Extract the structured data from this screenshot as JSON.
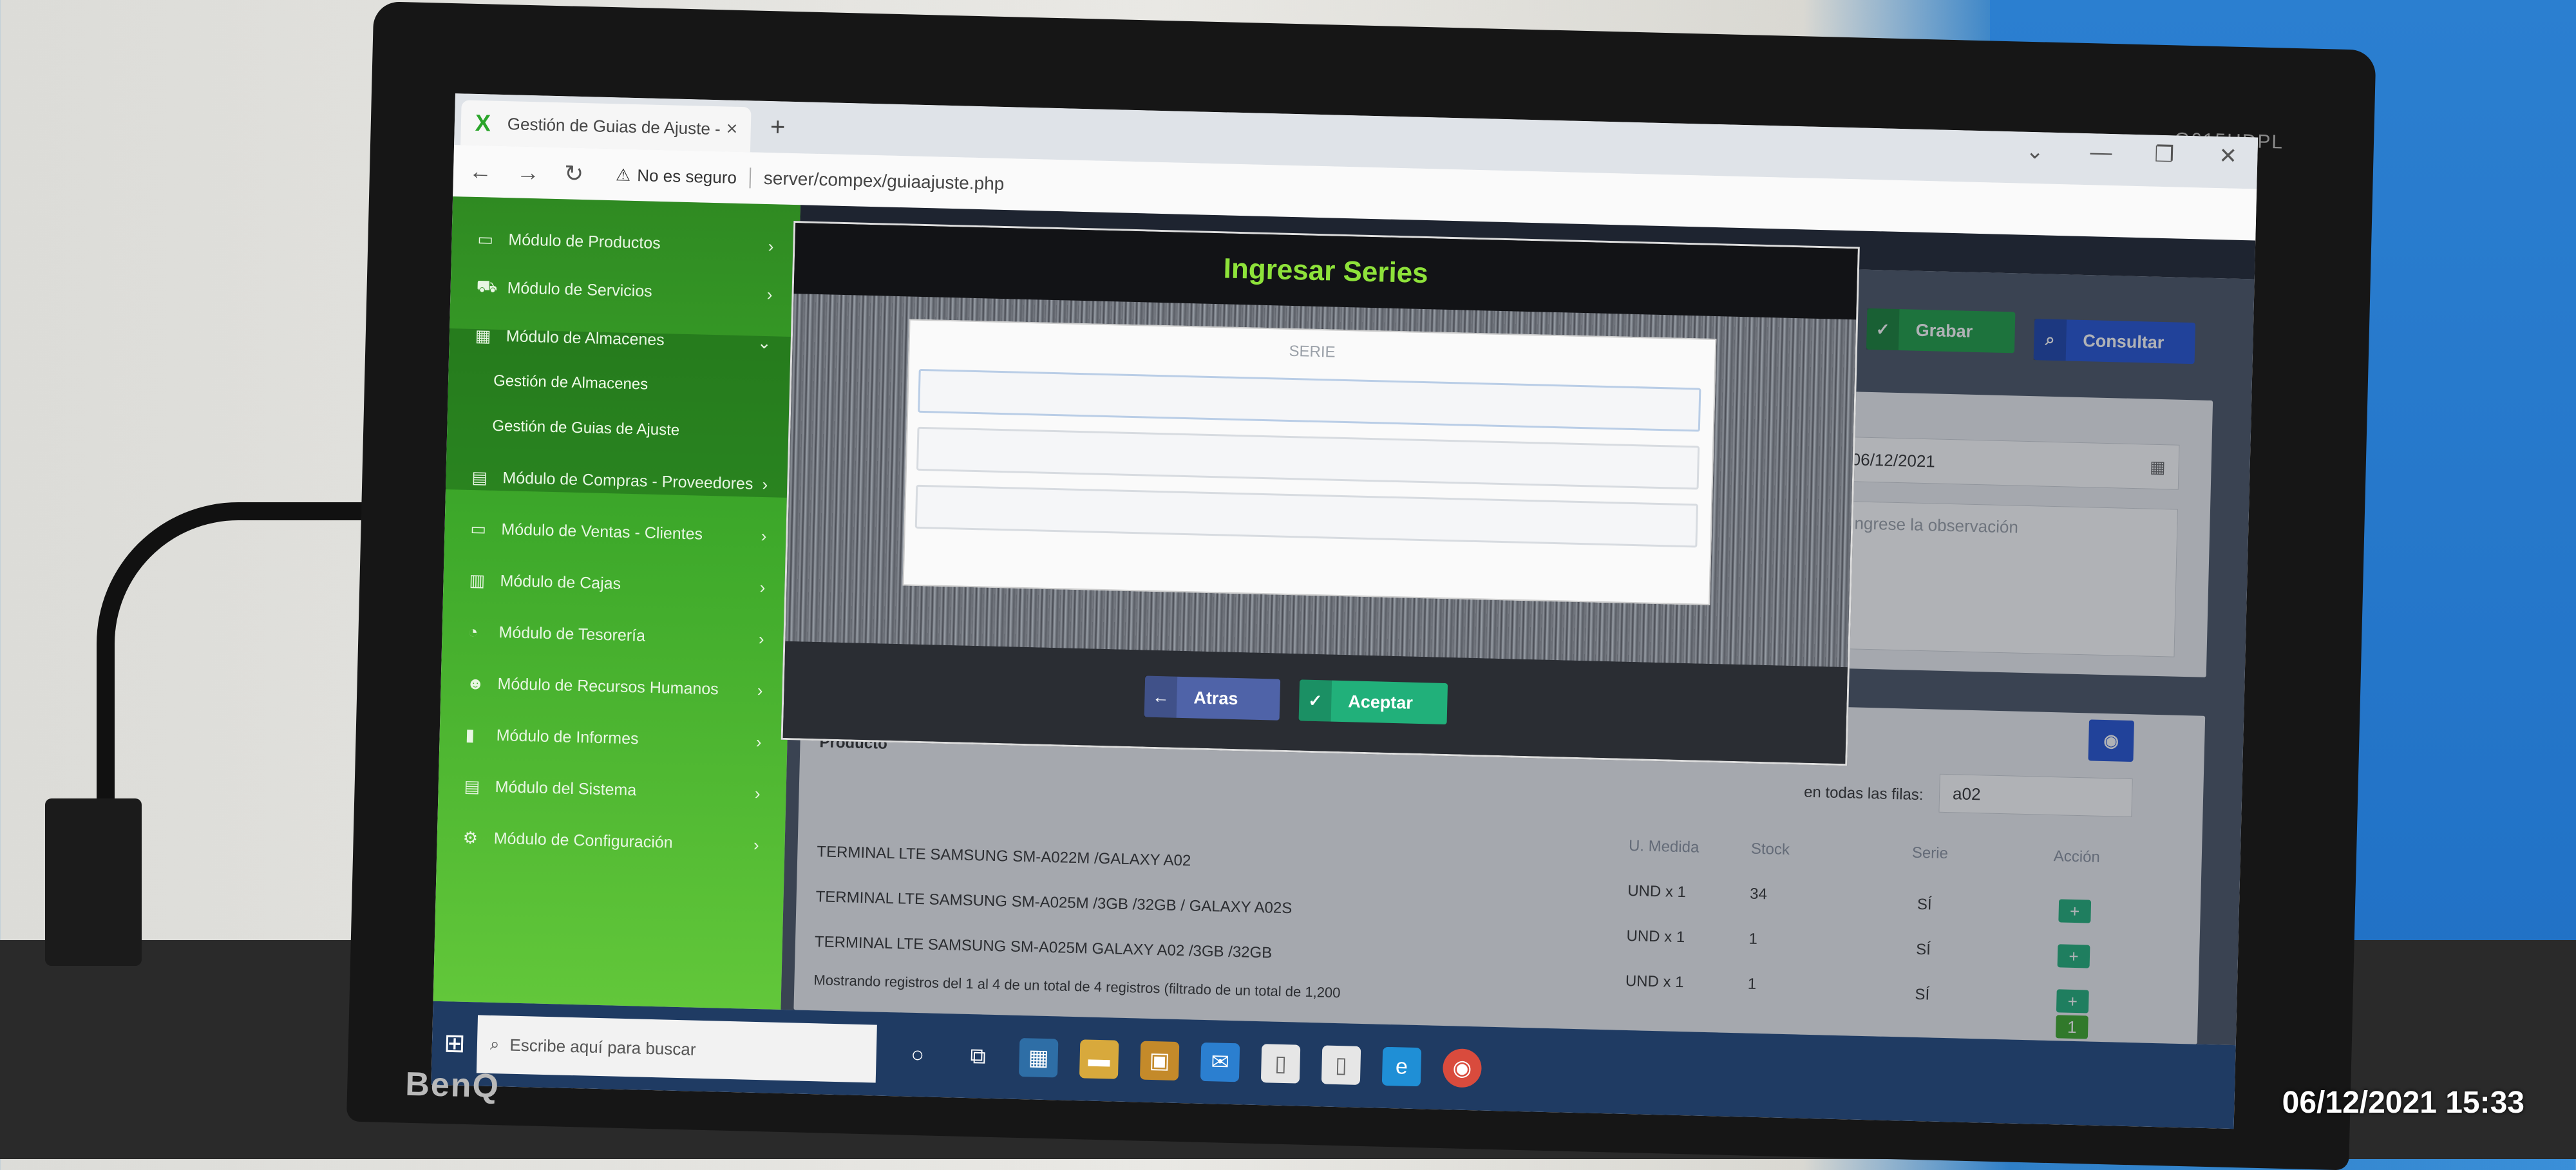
{
  "browser": {
    "tab_title": "Gestión de Guias de Ajuste - Xp",
    "tab_close": "×",
    "new_tab": "+",
    "security": "No es seguro",
    "url": "server/compex/guiaajuste.php"
  },
  "sidebar": {
    "items": [
      {
        "label": "Módulo de Productos"
      },
      {
        "label": "Módulo de Servicios"
      },
      {
        "label": "Módulo de Almacenes"
      },
      {
        "label": "Módulo de Compras - Proveedores"
      },
      {
        "label": "Módulo de Ventas - Clientes"
      },
      {
        "label": "Módulo de Cajas"
      },
      {
        "label": "Módulo de Tesorería"
      },
      {
        "label": "Módulo de Recursos Humanos"
      },
      {
        "label": "Módulo de Informes"
      },
      {
        "label": "Módulo del Sistema"
      },
      {
        "label": "Módulo de Configuración"
      }
    ],
    "subitems": [
      "Gestión de Almacenes",
      "Gestión de Guias de Ajuste"
    ]
  },
  "toolbar": {
    "save_label": "Grabar",
    "query_label": "Consultar"
  },
  "form": {
    "date": "06/12/2021",
    "observation_placeholder": "Ingrese la observación"
  },
  "table": {
    "title": "Producto",
    "filter_label": "en todas las filas:",
    "filter_value": "a02",
    "columns": [
      "U. Medida",
      "Stock",
      "Serie",
      "Acción"
    ],
    "rows": [
      {
        "product": "TERMINAL LTE SAMSUNG SM-A022M /GALAXY A02",
        "unit": "UND x 1",
        "stock": "34",
        "serie": "SÍ"
      },
      {
        "product": "TERMINAL LTE SAMSUNG SM-A025M /3GB /32GB / GALAXY A02S",
        "unit": "UND x 1",
        "stock": "1",
        "serie": "SÍ"
      },
      {
        "product": "TERMINAL LTE SAMSUNG SM-A025M GALAXY A02 /3GB /32GB",
        "unit": "UND x 1",
        "stock": "1",
        "serie": "SÍ"
      }
    ],
    "footer": "Mostrando registros del 1 al 4 de un total de 4 registros (filtrado de un total de 1,200",
    "page": "1"
  },
  "modal": {
    "title": "Ingresar Series",
    "column_label": "SERIE",
    "back_label": "Atras",
    "accept_label": "Aceptar"
  },
  "taskbar": {
    "search_placeholder": "Escribe aquí para buscar"
  },
  "monitor": {
    "brand": "BenQ",
    "model": "G615HDPL"
  },
  "photo_timestamp": "06/12/2021 15:33",
  "colors": {
    "sidebar_green": "#3da82a",
    "title_green": "#8ee23a",
    "save_green": "#1e9e45",
    "query_blue": "#2453d4"
  }
}
